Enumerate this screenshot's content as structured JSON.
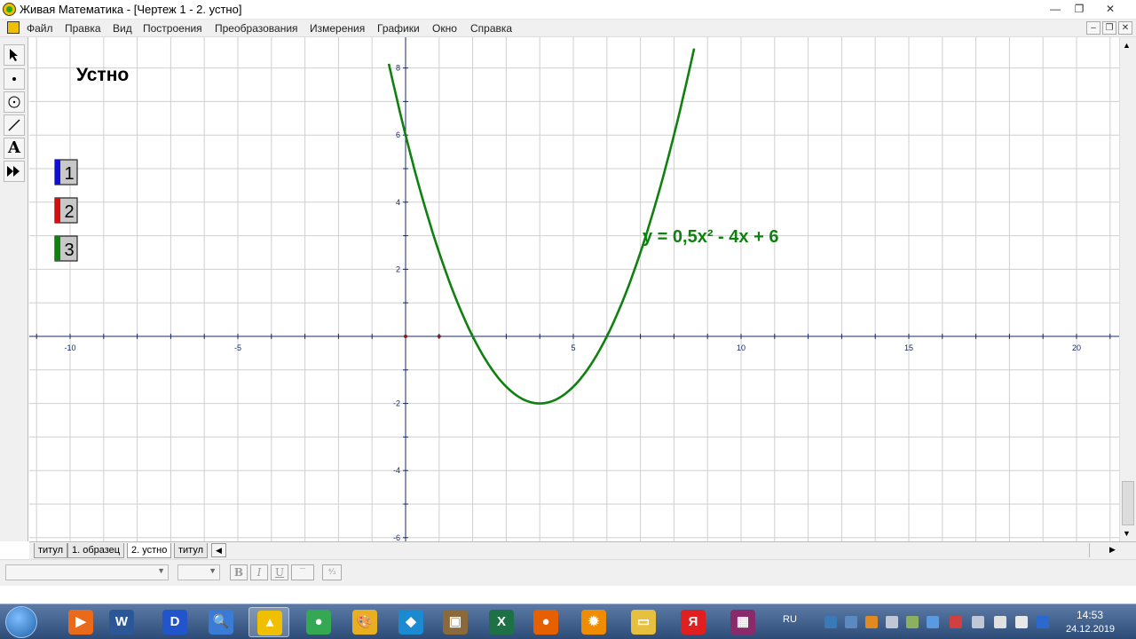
{
  "window": {
    "title": "Живая Математика - [Чертеж 1 - 2. устно]",
    "controls": {
      "minimize": "—",
      "restore": "❐",
      "close": "✕"
    }
  },
  "menu": {
    "items": [
      "Файл",
      "Правка",
      "Вид",
      "Построения",
      "Преобразования",
      "Измерения",
      "Графики",
      "Окно",
      "Справка"
    ]
  },
  "toolbox": {
    "tools": [
      "arrow-tool",
      "point-tool",
      "compass-tool",
      "line-tool",
      "text-tool",
      "custom-tool"
    ],
    "text_tool_label": "A"
  },
  "canvas": {
    "heading": "Устно",
    "buttons": [
      {
        "label": "1",
        "color": "#1010d0"
      },
      {
        "label": "2",
        "color": "#d01010"
      },
      {
        "label": "3",
        "color": "#108010"
      }
    ],
    "formula": "y = 0,5x² - 4x + 6",
    "formula_color": "#108010",
    "curve_color": "#108010",
    "axis_color": "#1a2a6a",
    "grid_color": "#cfcfcf"
  },
  "chart_data": {
    "type": "line",
    "title": "",
    "xlabel": "",
    "ylabel": "",
    "xlim": [
      -11.2,
      21.2
    ],
    "ylim": [
      -6.2,
      8.8
    ],
    "grid": true,
    "x_ticks": [
      -10,
      -5,
      5,
      10,
      15,
      20
    ],
    "y_ticks": [
      -6,
      -4,
      -2,
      2,
      4,
      6,
      8
    ],
    "x_tick_labels": [
      "-10",
      "-5",
      "5",
      "10",
      "15",
      "20"
    ],
    "y_tick_labels": [
      "-6",
      "-4",
      "-2",
      "2",
      "4",
      "6",
      "8"
    ],
    "series": [
      {
        "name": "y = 0,5x² - 4x + 6",
        "function": "0.5*x*x - 4*x + 6",
        "x_range": [
          -0.5,
          8.6
        ],
        "color": "#108010"
      }
    ],
    "points": [
      {
        "x": 0,
        "y": 0
      },
      {
        "x": 1,
        "y": 0
      }
    ],
    "vertex": {
      "x": 4,
      "y": -2
    },
    "roots": [
      2,
      6
    ],
    "y_intercept": 6
  },
  "tabs": {
    "items": [
      "титул",
      "1. образец",
      "2. устно",
      "титул"
    ],
    "active_index": 2
  },
  "format_bar": {
    "bold": "B",
    "italic": "I",
    "underline": "U"
  },
  "taskbar": {
    "language": "RU",
    "time": "14:53",
    "date": "24.12.2019",
    "apps": [
      {
        "name": "media-player-icon",
        "label": "▶",
        "color": "#e86a1a"
      },
      {
        "name": "word-icon",
        "label": "W",
        "color": "#2b5797"
      },
      {
        "name": "d-app-icon",
        "label": "D",
        "color": "#2255cc"
      },
      {
        "name": "search-magnifier-icon",
        "label": "🔍",
        "color": "#3a7bd5"
      },
      {
        "name": "live-math-icon",
        "label": "▲",
        "color": "#f0c000"
      },
      {
        "name": "chrome-icon",
        "label": "●",
        "color": "#34a853"
      },
      {
        "name": "paint-icon",
        "label": "🎨",
        "color": "#e8b020"
      },
      {
        "name": "globe-icon",
        "label": "◆",
        "color": "#1c8ad0"
      },
      {
        "name": "archive-box-icon",
        "label": "▣",
        "color": "#8a6a3a"
      },
      {
        "name": "excel-icon",
        "label": "X",
        "color": "#1e7145"
      },
      {
        "name": "firefox-icon",
        "label": "●",
        "color": "#e66000"
      },
      {
        "name": "settings-app-icon",
        "label": "✹",
        "color": "#f08c00"
      },
      {
        "name": "folder-icon",
        "label": "▭",
        "color": "#e8c040"
      },
      {
        "name": "yandex-icon",
        "label": "Я",
        "color": "#e02020"
      },
      {
        "name": "winrar-icon",
        "label": "▦",
        "color": "#8a2a6a"
      }
    ]
  }
}
